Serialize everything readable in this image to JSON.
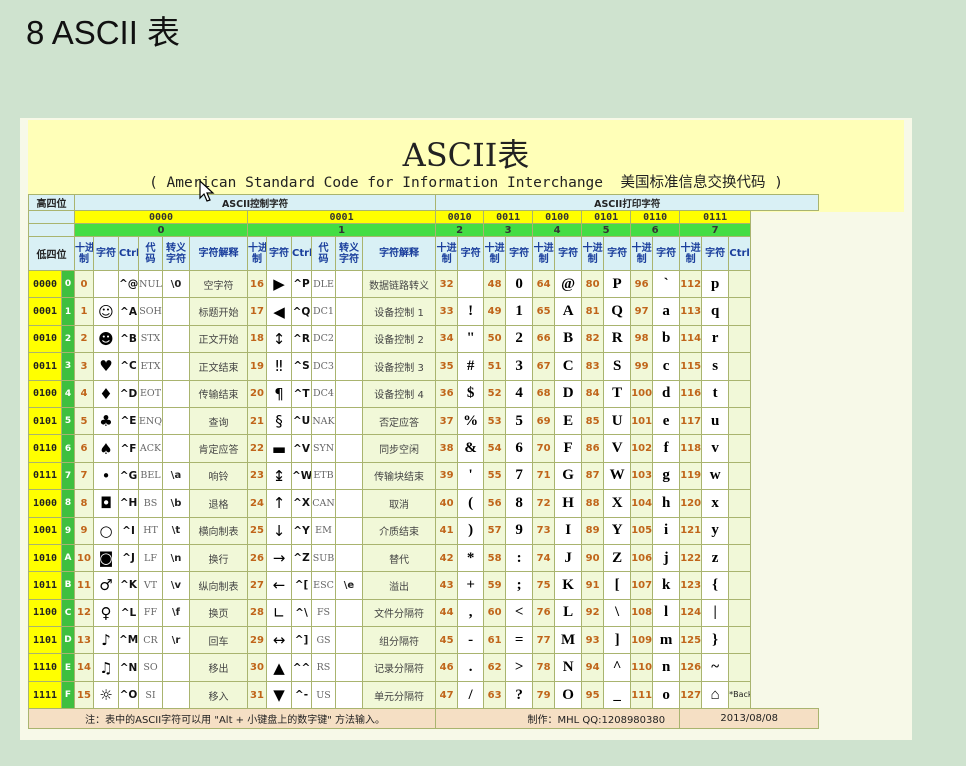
{
  "page_title": "8 ASCII 表",
  "title": "ASCII表",
  "subtitle": "( American Standard Code for Information Interchange  美国标准信息交换代码 )",
  "high_bits_label": "高四位",
  "low_bits_label": "低四位",
  "control_group_label": "ASCII控制字符",
  "print_group_label": "ASCII打印字符",
  "col_headers": {
    "dec": "十进制",
    "char": "字符",
    "ctrl": "Ctrl",
    "code": "代码",
    "esc": "转义字符",
    "explain": "字符解释"
  },
  "high_nibbles": [
    {
      "bin": "0000",
      "hex": "0"
    },
    {
      "bin": "0001",
      "hex": "1"
    },
    {
      "bin": "0010",
      "hex": "2"
    },
    {
      "bin": "0011",
      "hex": "3"
    },
    {
      "bin": "0100",
      "hex": "4"
    },
    {
      "bin": "0101",
      "hex": "5"
    },
    {
      "bin": "0110",
      "hex": "6"
    },
    {
      "bin": "0111",
      "hex": "7"
    }
  ],
  "rows": [
    {
      "bin": "0000",
      "hex": "0",
      "c0": [
        "0",
        "",
        "^@",
        "NUL",
        "\\0",
        "空字符"
      ],
      "c1": [
        "16",
        "▶",
        "^P",
        "DLE",
        "",
        "数据链路转义"
      ],
      "p": [
        [
          "32",
          ""
        ],
        [
          "48",
          "0"
        ],
        [
          "64",
          "@"
        ],
        [
          "80",
          "P"
        ],
        [
          "96",
          "`"
        ],
        [
          "112",
          "p"
        ]
      ]
    },
    {
      "bin": "0001",
      "hex": "1",
      "c0": [
        "1",
        "☺",
        "^A",
        "SOH",
        "",
        "标题开始"
      ],
      "c1": [
        "17",
        "◀",
        "^Q",
        "DC1",
        "",
        "设备控制 1"
      ],
      "p": [
        [
          "33",
          "!"
        ],
        [
          "49",
          "1"
        ],
        [
          "65",
          "A"
        ],
        [
          "81",
          "Q"
        ],
        [
          "97",
          "a"
        ],
        [
          "113",
          "q"
        ]
      ]
    },
    {
      "bin": "0010",
      "hex": "2",
      "c0": [
        "2",
        "☻",
        "^B",
        "STX",
        "",
        "正文开始"
      ],
      "c1": [
        "18",
        "↕",
        "^R",
        "DC2",
        "",
        "设备控制 2"
      ],
      "p": [
        [
          "34",
          "\""
        ],
        [
          "50",
          "2"
        ],
        [
          "66",
          "B"
        ],
        [
          "82",
          "R"
        ],
        [
          "98",
          "b"
        ],
        [
          "114",
          "r"
        ]
      ]
    },
    {
      "bin": "0011",
      "hex": "3",
      "c0": [
        "3",
        "♥",
        "^C",
        "ETX",
        "",
        "正文结束"
      ],
      "c1": [
        "19",
        "‼",
        "^S",
        "DC3",
        "",
        "设备控制 3"
      ],
      "p": [
        [
          "35",
          "#"
        ],
        [
          "51",
          "3"
        ],
        [
          "67",
          "C"
        ],
        [
          "83",
          "S"
        ],
        [
          "99",
          "c"
        ],
        [
          "115",
          "s"
        ]
      ]
    },
    {
      "bin": "0100",
      "hex": "4",
      "c0": [
        "4",
        "♦",
        "^D",
        "EOT",
        "",
        "传输结束"
      ],
      "c1": [
        "20",
        "¶",
        "^T",
        "DC4",
        "",
        "设备控制 4"
      ],
      "p": [
        [
          "36",
          "$"
        ],
        [
          "52",
          "4"
        ],
        [
          "68",
          "D"
        ],
        [
          "84",
          "T"
        ],
        [
          "100",
          "d"
        ],
        [
          "116",
          "t"
        ]
      ]
    },
    {
      "bin": "0101",
      "hex": "5",
      "c0": [
        "5",
        "♣",
        "^E",
        "ENQ",
        "",
        "查询"
      ],
      "c1": [
        "21",
        "§",
        "^U",
        "NAK",
        "",
        "否定应答"
      ],
      "p": [
        [
          "37",
          "%"
        ],
        [
          "53",
          "5"
        ],
        [
          "69",
          "E"
        ],
        [
          "85",
          "U"
        ],
        [
          "101",
          "e"
        ],
        [
          "117",
          "u"
        ]
      ]
    },
    {
      "bin": "0110",
      "hex": "6",
      "c0": [
        "6",
        "♠",
        "^F",
        "ACK",
        "",
        "肯定应答"
      ],
      "c1": [
        "22",
        "▬",
        "^V",
        "SYN",
        "",
        "同步空闲"
      ],
      "p": [
        [
          "38",
          "&"
        ],
        [
          "54",
          "6"
        ],
        [
          "70",
          "F"
        ],
        [
          "86",
          "V"
        ],
        [
          "102",
          "f"
        ],
        [
          "118",
          "v"
        ]
      ]
    },
    {
      "bin": "0111",
      "hex": "7",
      "c0": [
        "7",
        "•",
        "^G",
        "BEL",
        "\\a",
        "响铃"
      ],
      "c1": [
        "23",
        "↨",
        "^W",
        "ETB",
        "",
        "传输块结束"
      ],
      "p": [
        [
          "39",
          "'"
        ],
        [
          "55",
          "7"
        ],
        [
          "71",
          "G"
        ],
        [
          "87",
          "W"
        ],
        [
          "103",
          "g"
        ],
        [
          "119",
          "w"
        ]
      ]
    },
    {
      "bin": "1000",
      "hex": "8",
      "c0": [
        "8",
        "◘",
        "^H",
        "BS",
        "\\b",
        "退格"
      ],
      "c1": [
        "24",
        "↑",
        "^X",
        "CAN",
        "",
        "取消"
      ],
      "p": [
        [
          "40",
          "("
        ],
        [
          "56",
          "8"
        ],
        [
          "72",
          "H"
        ],
        [
          "88",
          "X"
        ],
        [
          "104",
          "h"
        ],
        [
          "120",
          "x"
        ]
      ]
    },
    {
      "bin": "1001",
      "hex": "9",
      "c0": [
        "9",
        "○",
        "^I",
        "HT",
        "\\t",
        "横向制表"
      ],
      "c1": [
        "25",
        "↓",
        "^Y",
        "EM",
        "",
        "介质结束"
      ],
      "p": [
        [
          "41",
          ")"
        ],
        [
          "57",
          "9"
        ],
        [
          "73",
          "I"
        ],
        [
          "89",
          "Y"
        ],
        [
          "105",
          "i"
        ],
        [
          "121",
          "y"
        ]
      ]
    },
    {
      "bin": "1010",
      "hex": "A",
      "c0": [
        "10",
        "◙",
        "^J",
        "LF",
        "\\n",
        "换行"
      ],
      "c1": [
        "26",
        "→",
        "^Z",
        "SUB",
        "",
        "替代"
      ],
      "p": [
        [
          "42",
          "*"
        ],
        [
          "58",
          ":"
        ],
        [
          "74",
          "J"
        ],
        [
          "90",
          "Z"
        ],
        [
          "106",
          "j"
        ],
        [
          "122",
          "z"
        ]
      ]
    },
    {
      "bin": "1011",
      "hex": "B",
      "c0": [
        "11",
        "♂",
        "^K",
        "VT",
        "\\v",
        "纵向制表"
      ],
      "c1": [
        "27",
        "←",
        "^[",
        "ESC",
        "\\e",
        "溢出"
      ],
      "p": [
        [
          "43",
          "+"
        ],
        [
          "59",
          ";"
        ],
        [
          "75",
          "K"
        ],
        [
          "91",
          "["
        ],
        [
          "107",
          "k"
        ],
        [
          "123",
          "{"
        ]
      ]
    },
    {
      "bin": "1100",
      "hex": "C",
      "c0": [
        "12",
        "♀",
        "^L",
        "FF",
        "\\f",
        "换页"
      ],
      "c1": [
        "28",
        "∟",
        "^\\",
        "FS",
        "",
        "文件分隔符"
      ],
      "p": [
        [
          "44",
          ","
        ],
        [
          "60",
          "<"
        ],
        [
          "76",
          "L"
        ],
        [
          "92",
          "\\"
        ],
        [
          "108",
          "l"
        ],
        [
          "124",
          "|"
        ]
      ]
    },
    {
      "bin": "1101",
      "hex": "D",
      "c0": [
        "13",
        "♪",
        "^M",
        "CR",
        "\\r",
        "回车"
      ],
      "c1": [
        "29",
        "↔",
        "^]",
        "GS",
        "",
        "组分隔符"
      ],
      "p": [
        [
          "45",
          "-"
        ],
        [
          "61",
          "="
        ],
        [
          "77",
          "M"
        ],
        [
          "93",
          "]"
        ],
        [
          "109",
          "m"
        ],
        [
          "125",
          "}"
        ]
      ]
    },
    {
      "bin": "1110",
      "hex": "E",
      "c0": [
        "14",
        "♫",
        "^N",
        "SO",
        "",
        "移出"
      ],
      "c1": [
        "30",
        "▲",
        "^^",
        "RS",
        "",
        "记录分隔符"
      ],
      "p": [
        [
          "46",
          "."
        ],
        [
          "62",
          ">"
        ],
        [
          "78",
          "N"
        ],
        [
          "94",
          "^"
        ],
        [
          "110",
          "n"
        ],
        [
          "126",
          "~"
        ]
      ]
    },
    {
      "bin": "1111",
      "hex": "F",
      "c0": [
        "15",
        "☼",
        "^O",
        "SI",
        "",
        "移入"
      ],
      "c1": [
        "31",
        "▼",
        "^-",
        "US",
        "",
        "单元分隔符"
      ],
      "p": [
        [
          "47",
          "/"
        ],
        [
          "63",
          "?"
        ],
        [
          "79",
          "O"
        ],
        [
          "95",
          "_"
        ],
        [
          "111",
          "o"
        ],
        [
          "127",
          "⌂"
        ]
      ]
    }
  ],
  "last_note": "*Backspace 代码：DEL",
  "footer": {
    "note": "注：表中的ASCII字符可以用 \"Alt + 小键盘上的数字键\" 方法输入。",
    "author": "制作：MHL  QQ:1208980380",
    "date": "2013/08/08"
  }
}
